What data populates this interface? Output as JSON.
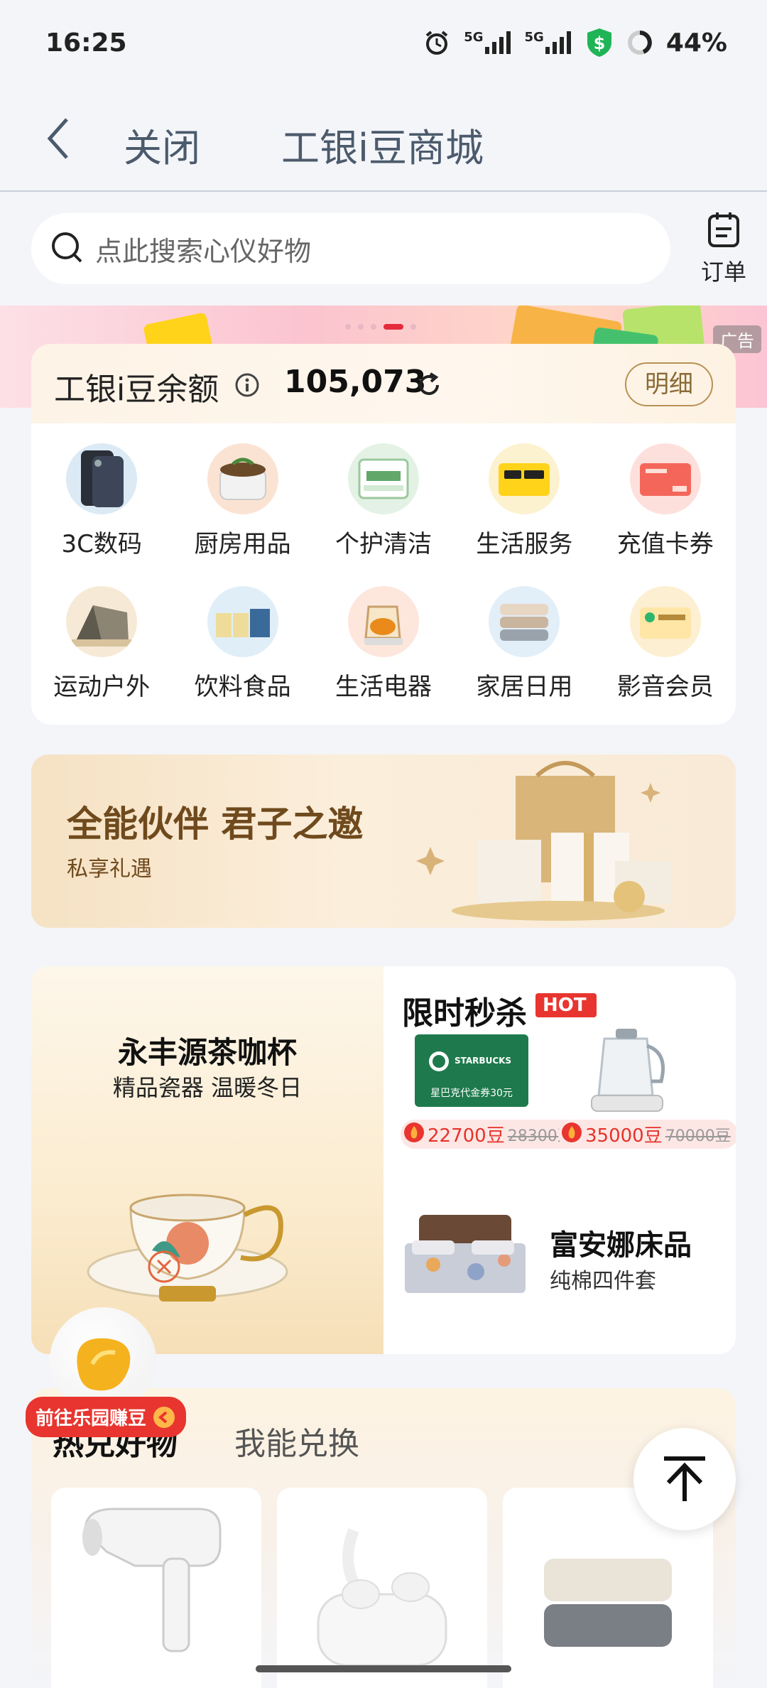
{
  "status_bar": {
    "time": "16:25",
    "network1": "5G",
    "network2": "5G",
    "battery": "44%"
  },
  "nav": {
    "close_label": "关闭",
    "title": "工银i豆商城"
  },
  "search": {
    "placeholder": "点此搜索心仪好物"
  },
  "orders": {
    "label": "订单"
  },
  "banner": {
    "ad_label": "广告",
    "slide_count": 5,
    "active_slide": 4
  },
  "balance": {
    "label": "工银i豆余额",
    "value": "105,073",
    "detail_label": "明细"
  },
  "categories": [
    {
      "label": "3C数码",
      "icon": "phone-icon"
    },
    {
      "label": "厨房用品",
      "icon": "cooker-icon"
    },
    {
      "label": "个护清洁",
      "icon": "tissue-icon"
    },
    {
      "label": "生活服务",
      "icon": "meituan-icon"
    },
    {
      "label": "充值卡券",
      "icon": "coupon-icon"
    },
    {
      "label": "运动户外",
      "icon": "tent-icon"
    },
    {
      "label": "饮料食品",
      "icon": "drinks-icon"
    },
    {
      "label": "生活电器",
      "icon": "kettle-icon"
    },
    {
      "label": "家居日用",
      "icon": "towel-icon"
    },
    {
      "label": "影音会员",
      "icon": "vip-icon"
    }
  ],
  "promo": {
    "title": "全能伙伴 君子之邀",
    "subtitle": "私享礼遇"
  },
  "feature": {
    "left_title": "永丰源茶咖杯",
    "left_subtitle": "精品瓷器 温暖冬日",
    "flash_title": "限时秒杀",
    "hot_tag": "HOT",
    "flash_items": [
      {
        "card_brand": "STARBUCKS",
        "card_text": "星巴克代金券30元",
        "price": "22700豆",
        "old_price": "28300豆"
      },
      {
        "price": "35000豆",
        "old_price": "70000豆"
      }
    ],
    "bed_title": "富安娜床品",
    "bed_subtitle": "纯棉四件套"
  },
  "hot_section": {
    "tab_active": "热兑好物",
    "tab_other": "我能兑换"
  },
  "float": {
    "earn_label": "前往乐园赚豆"
  },
  "colors": {
    "accent_red": "#e8352f",
    "gold": "#b89155",
    "bg": "#f4f5f9"
  }
}
